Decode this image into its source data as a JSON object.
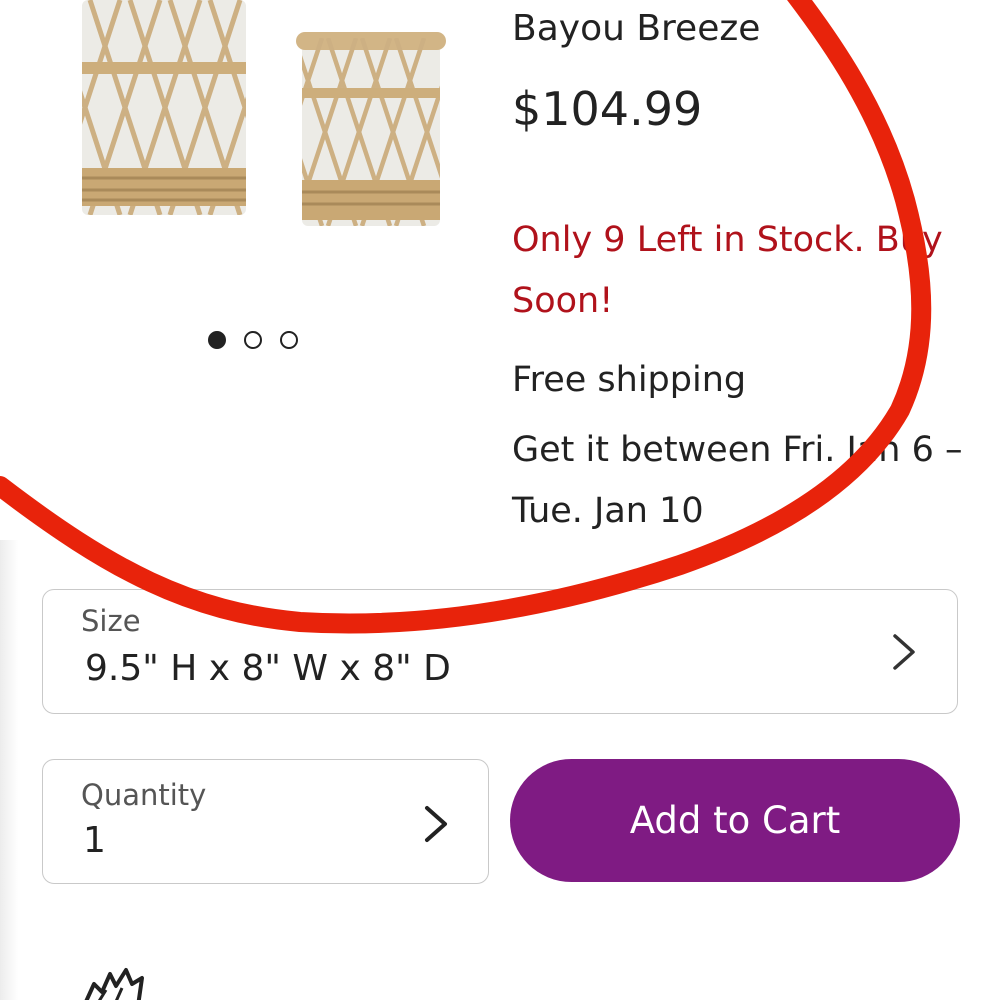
{
  "product": {
    "brand": "Bayou Breeze",
    "price": "$104.99",
    "image_icon": "wicker-hurricane-lantern-image",
    "carousel": {
      "total": 3,
      "active_index": 0
    }
  },
  "stock": {
    "message": "Only 9 Left in Stock. Buy Soon!",
    "color": "#b0121b"
  },
  "shipping": {
    "title": "Free shipping",
    "delivery": "Get it between Fri. Jan 6 – Tue. Jan 10"
  },
  "size_selector": {
    "label": "Size",
    "value": "9.5\" H x 8\" W x 8\" D",
    "icon": "chevron-right-icon"
  },
  "quantity_selector": {
    "label": "Quantity",
    "value": "1",
    "icon": "chevron-right-icon"
  },
  "cart_button": {
    "label": "Add to Cart",
    "color": "#7f1b83"
  },
  "annotation": {
    "color": "#e8230b",
    "shape": "freehand-circle"
  },
  "bottom_icon": "hand-icon"
}
